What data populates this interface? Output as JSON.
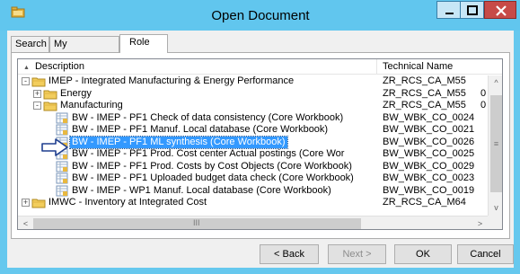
{
  "window": {
    "title": "Open Document",
    "minimize_icon": "minimize-icon",
    "maximize_icon": "maximize-icon",
    "close_icon": "close-icon"
  },
  "tabs": [
    {
      "label": "Search",
      "active": false
    },
    {
      "label": "My Documents",
      "active": false
    },
    {
      "label": "Role",
      "active": true
    }
  ],
  "grid": {
    "columns": {
      "description": "Description",
      "technical_name": "Technical Name"
    },
    "rows": [
      {
        "level": 0,
        "expander": "-",
        "icon": "folder-open-icon",
        "description": "IMEP - Integrated Manufacturing & Energy Performance",
        "technical_name": "ZR_RCS_CA_M55",
        "extra": ""
      },
      {
        "level": 1,
        "expander": "+",
        "icon": "folder-icon",
        "description": "Energy",
        "technical_name": "ZR_RCS_CA_M55",
        "extra": "0"
      },
      {
        "level": 1,
        "expander": "-",
        "icon": "folder-open-icon",
        "description": "Manufacturing",
        "technical_name": "ZR_RCS_CA_M55",
        "extra": "0"
      },
      {
        "level": 2,
        "expander": "",
        "icon": "workbook-icon",
        "description": "BW - IMEP - PF1 Check of data consistency (Core Workbook)",
        "technical_name": "BW_WBK_CO_0024",
        "extra": ""
      },
      {
        "level": 2,
        "expander": "",
        "icon": "workbook-icon",
        "description": "BW - IMEP - PF1 Manuf. Local database (Core Workbook)",
        "technical_name": "BW_WBK_CO_0021",
        "extra": ""
      },
      {
        "level": 2,
        "expander": "",
        "icon": "workbook-icon",
        "description": "BW - IMEP - PF1 ML synthesis  (Core Workbook)",
        "technical_name": "BW_WBK_CO_0026",
        "extra": "",
        "selected": true
      },
      {
        "level": 2,
        "expander": "",
        "icon": "workbook-icon",
        "description": "BW - IMEP - PF1 Prod. Cost center Actual postings  (Core Wor",
        "technical_name": "BW_WBK_CO_0025",
        "extra": ""
      },
      {
        "level": 2,
        "expander": "",
        "icon": "workbook-icon",
        "description": "BW - IMEP - PF1 Prod. Costs by Cost Objects (Core Workbook)",
        "technical_name": "BW_WBK_CO_0029",
        "extra": ""
      },
      {
        "level": 2,
        "expander": "",
        "icon": "workbook-icon",
        "description": "BW - IMEP - PF1 Uploaded budget data check (Core Workbook)",
        "technical_name": "BW_WBK_CO_0023",
        "extra": ""
      },
      {
        "level": 2,
        "expander": "",
        "icon": "workbook-icon",
        "description": "BW - IMEP - WP1 Manuf. Local database (Core Workbook)",
        "technical_name": "BW_WBK_CO_0019",
        "extra": ""
      },
      {
        "level": 0,
        "expander": "+",
        "icon": "folder-icon",
        "description": "IMWC - Inventory at Integrated Cost",
        "technical_name": "ZR_RCS_CA_M64",
        "extra": ""
      }
    ]
  },
  "scrollbar": {
    "up_arrow": "^",
    "down_arrow": "v",
    "left_arrow": "<",
    "right_arrow": ">",
    "v_grip": "≡",
    "h_grip": "III"
  },
  "buttons": {
    "back": "< Back",
    "next": "Next >",
    "ok": "OK",
    "cancel": "Cancel"
  },
  "colors": {
    "titlebar": "#61c6ee",
    "selection": "#3399ff",
    "close_button": "#c74b48",
    "annotation_arrow": "#1f3f8f"
  }
}
